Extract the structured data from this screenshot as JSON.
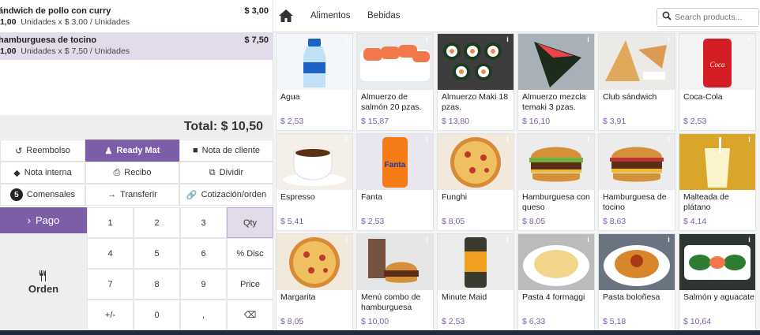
{
  "order": {
    "lines": [
      {
        "name": "ándwich de pollo con curry",
        "price": "$ 3,00",
        "qty": "1,00",
        "unit_text": "Unidades x $ 3,00 / Unidades"
      },
      {
        "name": "hamburguesa de tocino",
        "price": "$ 7,50",
        "qty": "1,00",
        "unit_text": "Unidades x $ 7,50 / Unidades"
      }
    ],
    "total": "Total: $ 10,50"
  },
  "controls": {
    "refund": "Reembolso",
    "ready_mat": "Ready Mat",
    "customer_note": "Nota de cliente",
    "internal_note": "Nota interna",
    "receipt": "Recibo",
    "split": "Dividir",
    "guests_count": "5",
    "guests": "Comensales",
    "transfer": "Transferir",
    "quote": "Cotización/orden"
  },
  "numpad": {
    "pay": "Pago",
    "order": "Orden",
    "keys": [
      "1",
      "2",
      "3",
      "Qty",
      "4",
      "5",
      "6",
      "% Disc",
      "7",
      "8",
      "9",
      "Price",
      "+/-",
      "0",
      ",",
      "⌫"
    ]
  },
  "topbar": {
    "categories": [
      "Alimentos",
      "Bebidas"
    ],
    "search_placeholder": "Search products..."
  },
  "products": [
    {
      "name": "Agua",
      "price": "$ 2,53",
      "icon": "water-bottle"
    },
    {
      "name": "Almuerzo de salmón 20 pzas.",
      "price": "$ 15,87",
      "icon": "salmon-sushi"
    },
    {
      "name": "Almuerzo Maki 18 pzas.",
      "price": "$ 13,80",
      "icon": "maki-rolls"
    },
    {
      "name": "Almuerzo mezcla temaki 3 pzas.",
      "price": "$ 16,10",
      "icon": "temaki"
    },
    {
      "name": "Club sándwich",
      "price": "$ 3,91",
      "icon": "club-sandwich"
    },
    {
      "name": "Coca-Cola",
      "price": "$ 2,53",
      "icon": "cola-can"
    },
    {
      "name": "Espresso",
      "price": "$ 5,41",
      "icon": "espresso-cup"
    },
    {
      "name": "Fanta",
      "price": "$ 2,53",
      "icon": "fanta-can"
    },
    {
      "name": "Funghi",
      "price": "$ 8,05",
      "icon": "pizza"
    },
    {
      "name": "Hamburguesa con queso",
      "price": "$ 8,05",
      "icon": "cheeseburger"
    },
    {
      "name": "Hamburguesa de tocino",
      "price": "$ 8,63",
      "icon": "bacon-burger"
    },
    {
      "name": "Malteada de plátano",
      "price": "$ 4,14",
      "icon": "milkshake"
    },
    {
      "name": "Margarita",
      "price": "$ 8,05",
      "icon": "pizza"
    },
    {
      "name": "Menú combo de hamburguesa",
      "price": "$ 10,00",
      "icon": "burger-combo"
    },
    {
      "name": "Minute Maid",
      "price": "$ 2,53",
      "icon": "juice-can"
    },
    {
      "name": "Pasta 4 formaggi",
      "price": "$ 6,33",
      "icon": "pasta"
    },
    {
      "name": "Pasta boloñesa",
      "price": "$ 5,18",
      "icon": "pasta-bolognese"
    },
    {
      "name": "Salmón y aguacate",
      "price": "$ 10,64",
      "icon": "salmon-avocado"
    }
  ],
  "colors": {
    "accent": "#7b5ea7",
    "selected_line": "#e2dcea",
    "price": "#7b5ea7"
  }
}
